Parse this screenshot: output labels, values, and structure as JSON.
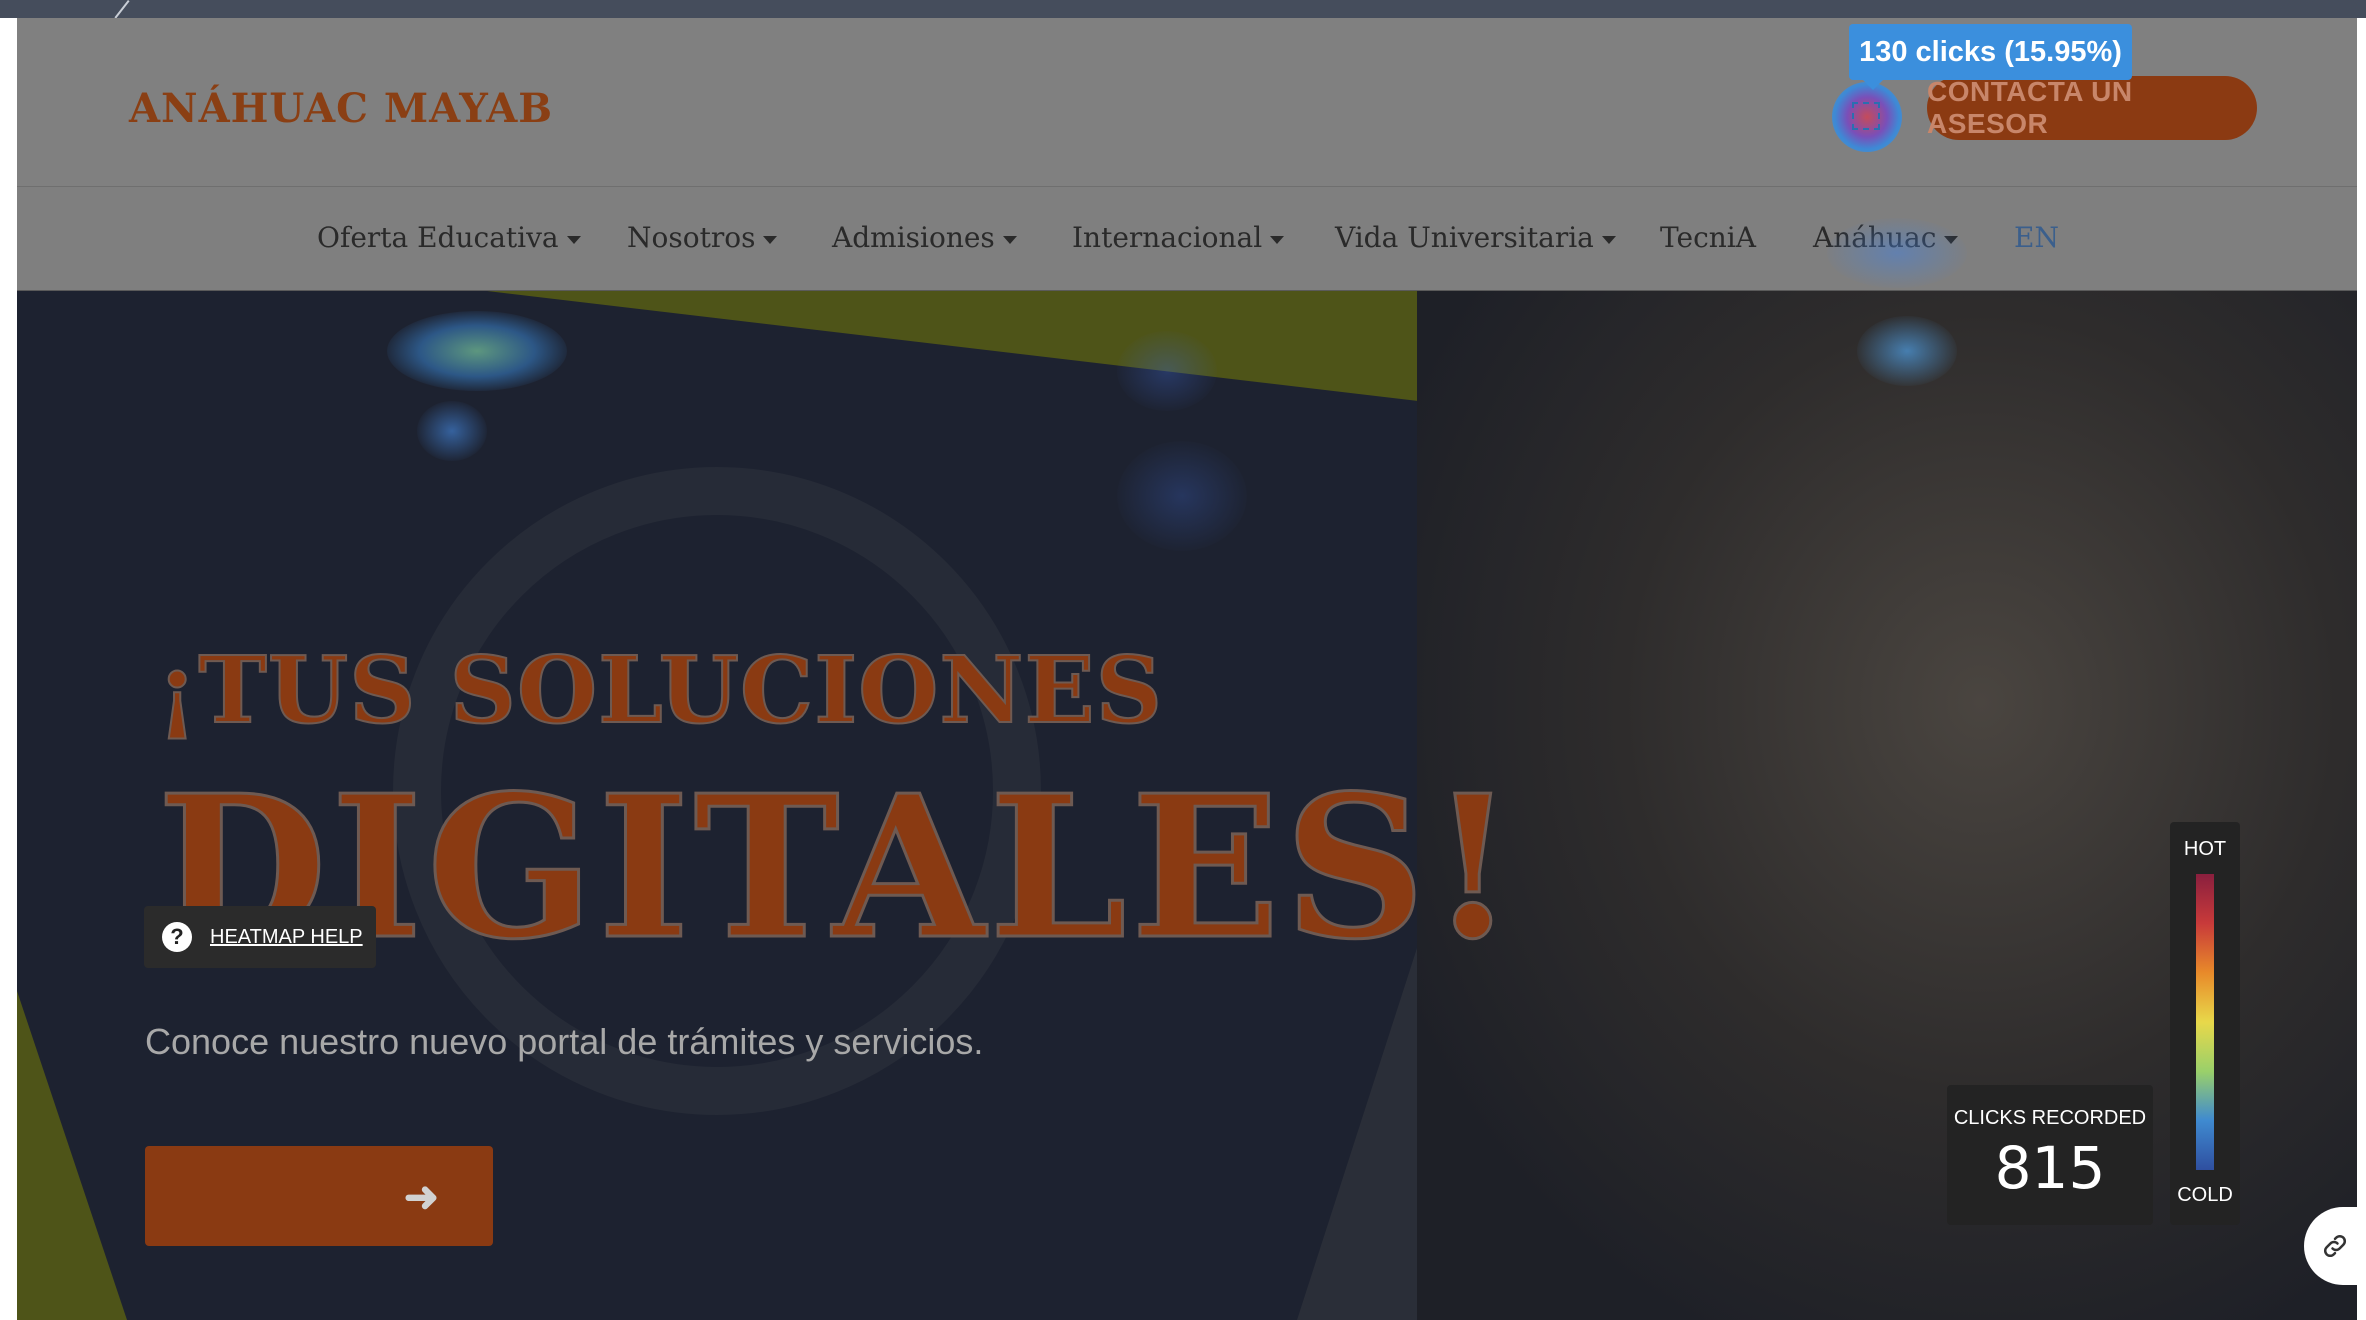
{
  "site": {
    "logo": "ANÁHUAC MAYAB",
    "cta_label": "CONTACTA UN ASESOR"
  },
  "nav": {
    "items": [
      {
        "label": "Oferta Educativa",
        "has_dropdown": true
      },
      {
        "label": "Nosotros",
        "has_dropdown": true
      },
      {
        "label": "Admisiones",
        "has_dropdown": true
      },
      {
        "label": "Internacional",
        "has_dropdown": true
      },
      {
        "label": "Vida Universitaria",
        "has_dropdown": true
      },
      {
        "label": "TecniA",
        "has_dropdown": false
      },
      {
        "label": "Anáhuac",
        "has_dropdown": true
      },
      {
        "label": "EN",
        "has_dropdown": false
      }
    ]
  },
  "hero": {
    "headline_line1": "¡TUS SOLUCIONES",
    "headline_line2": "DIGITALES!",
    "subtitle": "Conoce nuestro nuevo portal de trámites y servicios.",
    "button_icon": "arrow-right-icon"
  },
  "heatmap": {
    "tooltip": "130 clicks (15.95%)",
    "help_label": "HEATMAP HELP",
    "clicks_recorded_label": "CLICKS RECORDED",
    "clicks_recorded_value": "815",
    "legend_hot": "HOT",
    "legend_cold": "COLD"
  },
  "colors": {
    "brand_orange": "#8a3a12",
    "tooltip_blue": "#3b8fdd",
    "overlay_dark": "#232323"
  }
}
